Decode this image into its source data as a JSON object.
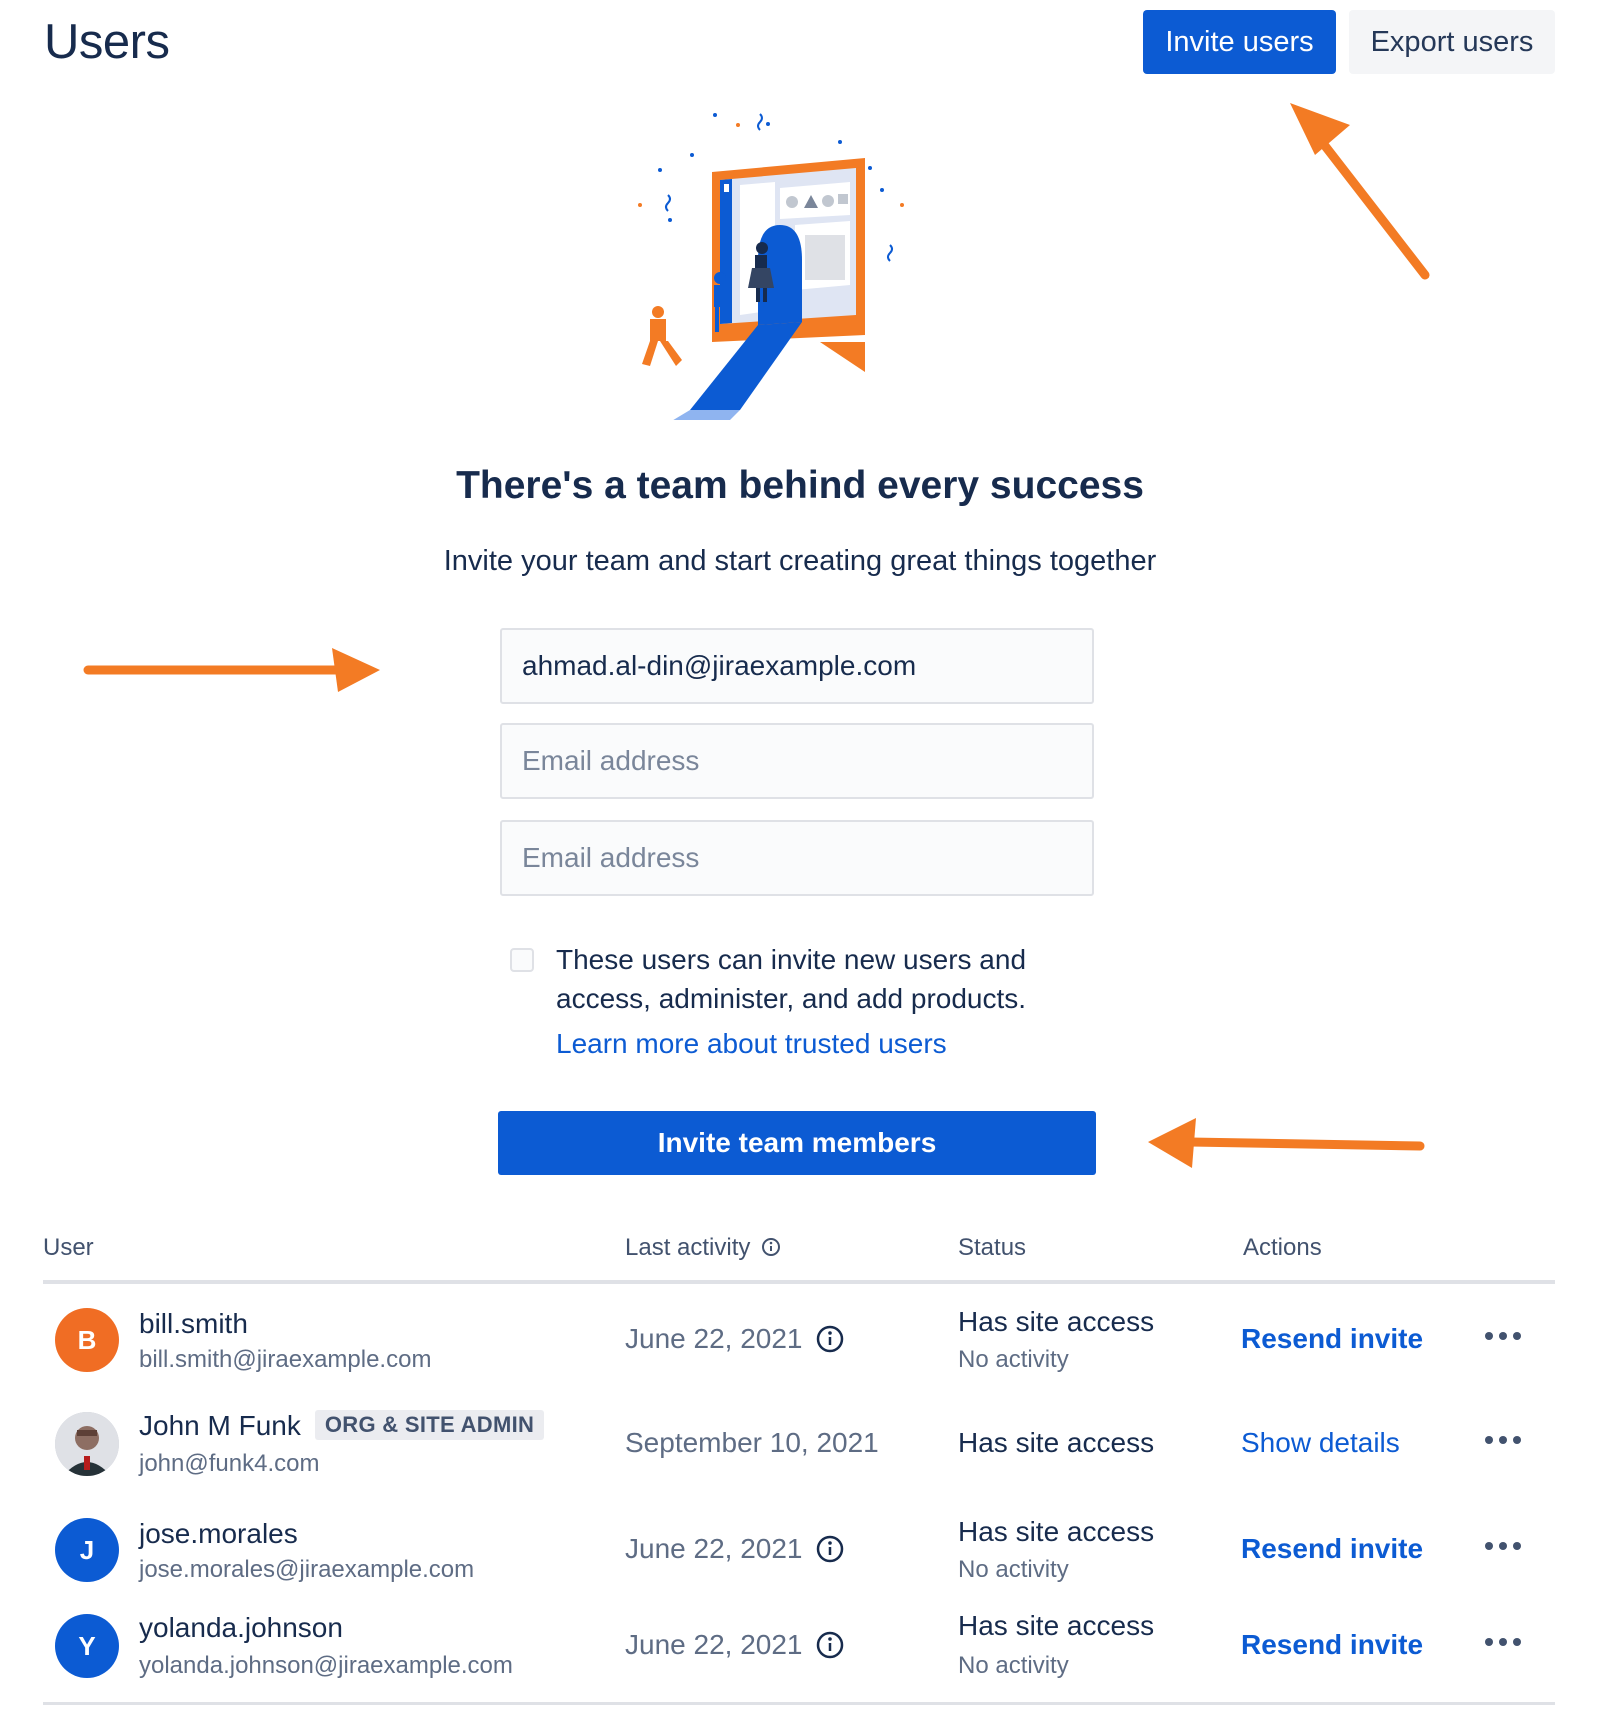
{
  "header": {
    "title": "Users",
    "invite_label": "Invite users",
    "export_label": "Export users"
  },
  "hero": {
    "heading": "There's a team behind every success",
    "subheading": "Invite your team and start creating great things together"
  },
  "invite_form": {
    "emails": [
      {
        "value": "ahmad.al-din@jiraexample.com",
        "placeholder": "Email address"
      },
      {
        "value": "",
        "placeholder": "Email address"
      },
      {
        "value": "",
        "placeholder": "Email address"
      }
    ],
    "trusted_checked": false,
    "trusted_label": "These users can invite new users and access, administer, and add products.",
    "learn_more": "Learn more about trusted users",
    "submit_label": "Invite team members"
  },
  "table": {
    "columns": {
      "user": "User",
      "last_activity": "Last activity",
      "status": "Status",
      "actions": "Actions"
    },
    "rows": [
      {
        "avatar_letter": "B",
        "avatar_color": "#f06d24",
        "name": "bill.smith",
        "email": "bill.smith@jiraexample.com",
        "badge": "",
        "last_activity": "June 22, 2021",
        "status": "Has site access",
        "status_sub": "No activity",
        "action": "Resend invite"
      },
      {
        "avatar_letter": "",
        "avatar_color": "#6b778c",
        "name": "John M Funk",
        "email": "john@funk4.com",
        "badge": "ORG & SITE ADMIN",
        "last_activity": "September 10, 2021",
        "status": "Has site access",
        "status_sub": "",
        "action": "Show details"
      },
      {
        "avatar_letter": "J",
        "avatar_color": "#0c5bd3",
        "name": "jose.morales",
        "email": "jose.morales@jiraexample.com",
        "badge": "",
        "last_activity": "June 22, 2021",
        "status": "Has site access",
        "status_sub": "No activity",
        "action": "Resend invite"
      },
      {
        "avatar_letter": "Y",
        "avatar_color": "#0c5bd3",
        "name": "yolanda.johnson",
        "email": "yolanda.johnson@jiraexample.com",
        "badge": "",
        "last_activity": "June 22, 2021",
        "status": "Has site access",
        "status_sub": "No activity",
        "action": "Resend invite"
      }
    ]
  },
  "colors": {
    "primary": "#0c5bd3",
    "annotation_arrow": "#f37b24",
    "text": "#172b4d",
    "muted": "#5e6c84"
  }
}
